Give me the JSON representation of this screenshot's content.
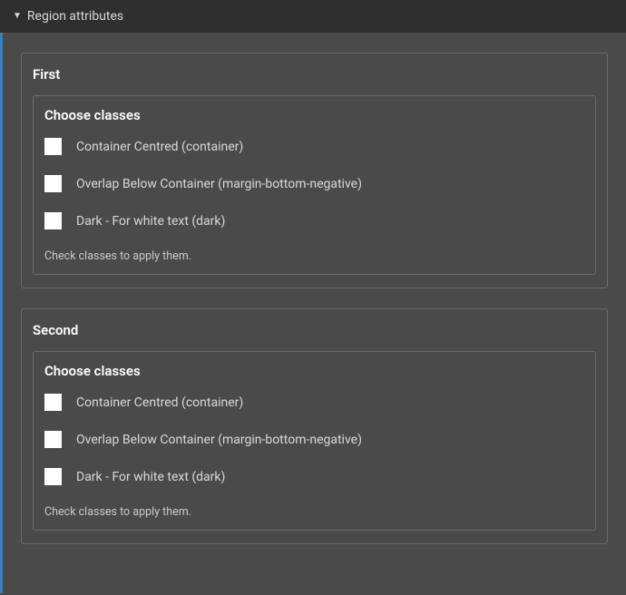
{
  "header": {
    "title": "Region attributes"
  },
  "regions": [
    {
      "title": "First",
      "classes_title": "Choose classes",
      "options": [
        {
          "label": "Container Centred (container)"
        },
        {
          "label": "Overlap Below Container (margin-bottom-negative)"
        },
        {
          "label": "Dark - For white text (dark)"
        }
      ],
      "help": "Check classes to apply them."
    },
    {
      "title": "Second",
      "classes_title": "Choose classes",
      "options": [
        {
          "label": "Container Centred (container)"
        },
        {
          "label": "Overlap Below Container (margin-bottom-negative)"
        },
        {
          "label": "Dark - For white text (dark)"
        }
      ],
      "help": "Check classes to apply them."
    }
  ]
}
